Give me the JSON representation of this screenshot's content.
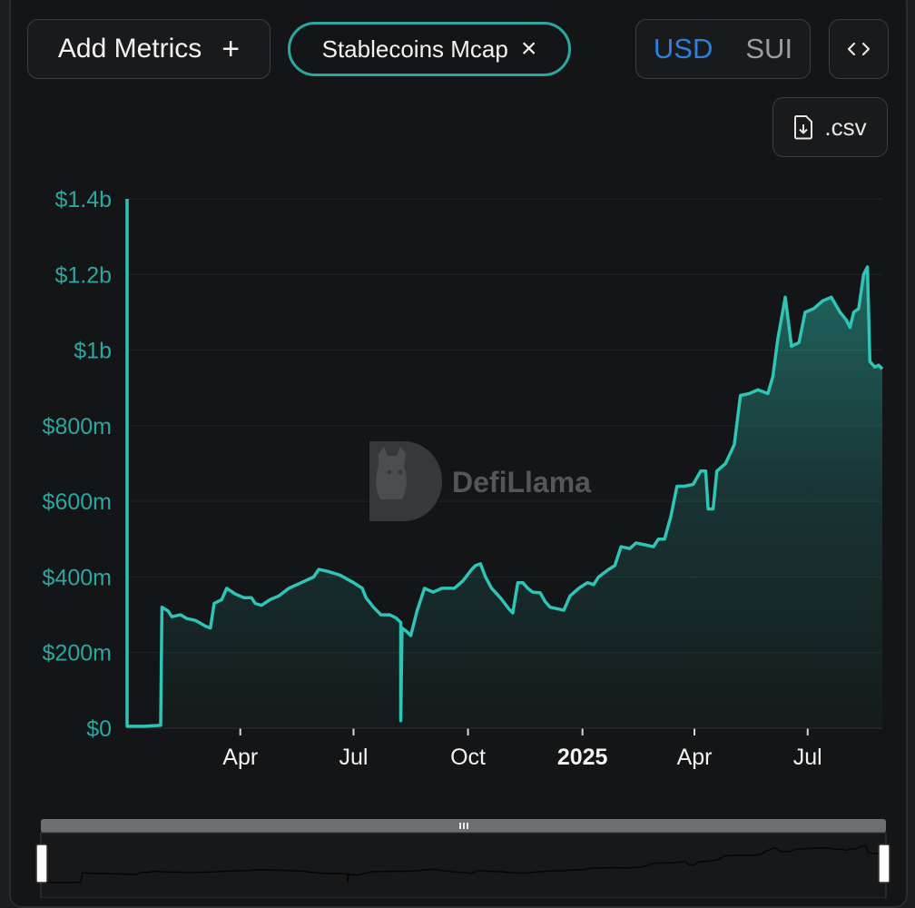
{
  "toolbar": {
    "add_metrics_label": "Add Metrics",
    "add_metrics_icon": "plus-icon",
    "metric_chip_label": "Stablecoins Mcap",
    "metric_chip_icon": "close-icon",
    "currency_options": [
      "USD",
      "SUI"
    ],
    "currency_selected": "USD",
    "embed_icon": "code-brackets-icon",
    "csv_label": ".csv",
    "csv_icon": "file-download-icon"
  },
  "watermark": {
    "text": "DefiLlama",
    "icon": "llama-logo-icon"
  },
  "colors": {
    "accent": "#2aa8a0",
    "line": "#2ec4b6",
    "selected_currency": "#2f7fe0",
    "background": "#141517"
  },
  "chart_data": {
    "type": "area",
    "title": "",
    "xlabel": "",
    "ylabel": "",
    "y_ticks": [
      "$0",
      "$200m",
      "$400m",
      "$600m",
      "$800m",
      "$1b",
      "$1.2b",
      "$1.4b"
    ],
    "x_ticks": [
      "Apr",
      "Jul",
      "Oct",
      "2025",
      "Apr",
      "Jul"
    ],
    "x_ticks_bold": [
      false,
      false,
      false,
      true,
      false,
      false
    ],
    "ylim": [
      0,
      1400
    ],
    "y_unit": "USD millions",
    "grid": true,
    "series": [
      {
        "name": "Stablecoins Mcap",
        "points": [
          [
            "2024-01-01",
            1400
          ],
          [
            "2024-01-01",
            5
          ],
          [
            "2024-01-15",
            5
          ],
          [
            "2024-01-28",
            8
          ],
          [
            "2024-01-29",
            320
          ],
          [
            "2024-02-03",
            310
          ],
          [
            "2024-02-06",
            295
          ],
          [
            "2024-02-13",
            300
          ],
          [
            "2024-02-18",
            290
          ],
          [
            "2024-02-25",
            285
          ],
          [
            "2024-03-04",
            270
          ],
          [
            "2024-03-08",
            265
          ],
          [
            "2024-03-11",
            330
          ],
          [
            "2024-03-17",
            340
          ],
          [
            "2024-03-21",
            370
          ],
          [
            "2024-03-28",
            355
          ],
          [
            "2024-04-04",
            345
          ],
          [
            "2024-04-10",
            345
          ],
          [
            "2024-04-13",
            330
          ],
          [
            "2024-04-18",
            325
          ],
          [
            "2024-04-25",
            340
          ],
          [
            "2024-05-02",
            350
          ],
          [
            "2024-05-10",
            370
          ],
          [
            "2024-05-20",
            385
          ],
          [
            "2024-05-30",
            400
          ],
          [
            "2024-06-03",
            420
          ],
          [
            "2024-06-10",
            415
          ],
          [
            "2024-06-20",
            405
          ],
          [
            "2024-07-01",
            385
          ],
          [
            "2024-07-08",
            370
          ],
          [
            "2024-07-11",
            345
          ],
          [
            "2024-07-17",
            320
          ],
          [
            "2024-07-23",
            300
          ],
          [
            "2024-07-30",
            300
          ],
          [
            "2024-08-04",
            292
          ],
          [
            "2024-08-08",
            280
          ],
          [
            "2024-08-08",
            20
          ],
          [
            "2024-08-09",
            265
          ],
          [
            "2024-08-13",
            255
          ],
          [
            "2024-08-16",
            245
          ],
          [
            "2024-08-21",
            310
          ],
          [
            "2024-08-27",
            370
          ],
          [
            "2024-09-03",
            360
          ],
          [
            "2024-09-10",
            370
          ],
          [
            "2024-09-20",
            370
          ],
          [
            "2024-09-27",
            390
          ],
          [
            "2024-10-04",
            420
          ],
          [
            "2024-10-07",
            430
          ],
          [
            "2024-10-11",
            435
          ],
          [
            "2024-10-15",
            400
          ],
          [
            "2024-10-20",
            370
          ],
          [
            "2024-10-27",
            345
          ],
          [
            "2024-11-03",
            315
          ],
          [
            "2024-11-06",
            305
          ],
          [
            "2024-11-10",
            385
          ],
          [
            "2024-11-14",
            385
          ],
          [
            "2024-11-18",
            370
          ],
          [
            "2024-11-22",
            360
          ],
          [
            "2024-11-28",
            358
          ],
          [
            "2024-12-02",
            335
          ],
          [
            "2024-12-06",
            320
          ],
          [
            "2024-12-13",
            315
          ],
          [
            "2024-12-17",
            312
          ],
          [
            "2024-12-22",
            350
          ],
          [
            "2024-12-29",
            370
          ],
          [
            "2025-01-05",
            385
          ],
          [
            "2025-01-10",
            380
          ],
          [
            "2025-01-14",
            400
          ],
          [
            "2025-01-22",
            420
          ],
          [
            "2025-01-27",
            430
          ],
          [
            "2025-02-01",
            480
          ],
          [
            "2025-02-08",
            475
          ],
          [
            "2025-02-13",
            490
          ],
          [
            "2025-02-20",
            485
          ],
          [
            "2025-02-27",
            480
          ],
          [
            "2025-03-03",
            500
          ],
          [
            "2025-03-08",
            500
          ],
          [
            "2025-03-13",
            560
          ],
          [
            "2025-03-18",
            640
          ],
          [
            "2025-03-24",
            640
          ],
          [
            "2025-03-31",
            645
          ],
          [
            "2025-04-06",
            680
          ],
          [
            "2025-04-10",
            680
          ],
          [
            "2025-04-12",
            580
          ],
          [
            "2025-04-16",
            580
          ],
          [
            "2025-04-19",
            680
          ],
          [
            "2025-04-26",
            700
          ],
          [
            "2025-05-03",
            750
          ],
          [
            "2025-05-08",
            880
          ],
          [
            "2025-05-15",
            885
          ],
          [
            "2025-05-22",
            895
          ],
          [
            "2025-05-30",
            885
          ],
          [
            "2025-06-03",
            930
          ],
          [
            "2025-06-07",
            1030
          ],
          [
            "2025-06-13",
            1140
          ],
          [
            "2025-06-18",
            1010
          ],
          [
            "2025-06-24",
            1020
          ],
          [
            "2025-06-29",
            1100
          ],
          [
            "2025-07-06",
            1110
          ],
          [
            "2025-07-13",
            1130
          ],
          [
            "2025-07-20",
            1140
          ],
          [
            "2025-07-27",
            1100
          ],
          [
            "2025-08-01",
            1080
          ],
          [
            "2025-08-04",
            1060
          ],
          [
            "2025-08-07",
            1100
          ],
          [
            "2025-08-11",
            1110
          ],
          [
            "2025-08-15",
            1200
          ],
          [
            "2025-08-18",
            1220
          ],
          [
            "2025-08-20",
            970
          ],
          [
            "2025-08-24",
            955
          ],
          [
            "2025-08-27",
            960
          ],
          [
            "2025-08-30",
            950
          ]
        ]
      }
    ],
    "overview_visible": true
  }
}
